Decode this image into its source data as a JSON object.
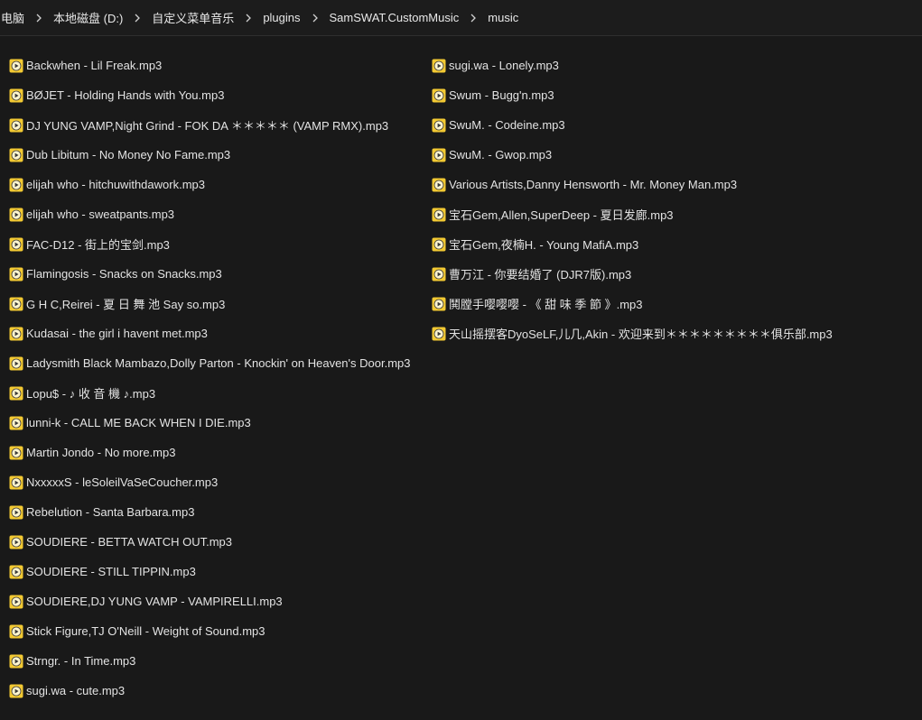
{
  "breadcrumb": {
    "items": [
      "电脑",
      "本地磁盘 (D:)",
      "自定义菜单音乐",
      "plugins",
      "SamSWAT.CustomMusic",
      "music"
    ]
  },
  "colors": {
    "background": "#191919",
    "file_icon": "#f2c933",
    "file_icon_play": "#3a3a3a"
  },
  "icons": {
    "file": "audio-file-icon",
    "separator": "chevron-right-icon"
  },
  "files": {
    "left": [
      "Backwhen - Lil Freak.mp3",
      "BØJET - Holding Hands with You.mp3",
      "DJ YUNG VAMP,Night Grind - FOK DA ＊＊＊＊＊ (VAMP RMX).mp3",
      "Dub Libitum - No Money No Fame.mp3",
      "elijah who - hitchuwithdawork.mp3",
      "elijah who - sweatpants.mp3",
      "FAC-D12 - 街上的宝剑.mp3",
      "Flamingosis - Snacks on Snacks.mp3",
      "G H C,Reirei - 夏 日 舞 池 Say so.mp3",
      "Kudasai - the girl i havent met.mp3",
      "Ladysmith Black Mambazo,Dolly Parton - Knockin' on Heaven's Door.mp3",
      "Lopu$ - ♪ 收 音 機 ♪.mp3",
      "lunni-k - CALL ME BACK WHEN I DIE.mp3",
      "Martin Jondo - No more.mp3",
      "NxxxxxS - leSoleilVaSeCoucher.mp3",
      "Rebelution - Santa Barbara.mp3",
      "SOUDIERE - BETTA WATCH OUT.mp3",
      "SOUDIERE - STILL TIPPIN.mp3",
      "SOUDIERE,DJ YUNG VAMP - VAMPIRELLI.mp3",
      "Stick Figure,TJ O'Neill - Weight of Sound.mp3",
      "Strngr. - In Time.mp3",
      "sugi.wa - cute.mp3"
    ],
    "right": [
      "sugi.wa - Lonely.mp3",
      "Swum - Bugg'n.mp3",
      "SwuM. - Codeine.mp3",
      "SwuM. - Gwop.mp3",
      "Various Artists,Danny Hensworth - Mr. Money Man.mp3",
      "宝石Gem,Allen,SuperDeep - 夏日发廊.mp3",
      "宝石Gem,夜楠H. - Young MafiA.mp3",
      "曹万江 - 你要结婚了 (DJR7版).mp3",
      "鬨膛手嘤嘤嘤 - 《 甜 味 季 節 》.mp3",
      "天山摇摆客DyoSeLF,儿几,Akin - 欢迎来到＊＊＊＊＊＊＊＊＊俱乐部.mp3"
    ]
  }
}
